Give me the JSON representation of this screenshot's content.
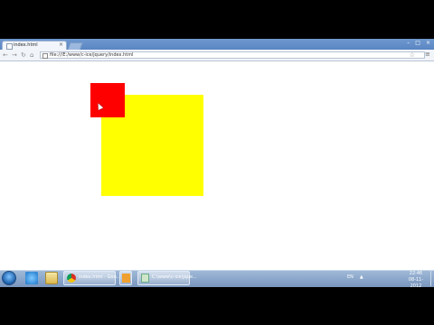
{
  "browser": {
    "tab_title": "index.html",
    "tab_close": "×",
    "url": "file:///E:/www/c-ice/jquery/index.html",
    "nav": {
      "back": "←",
      "forward": "→",
      "reload": "↻",
      "home": "⌂"
    },
    "star": "☆",
    "wrench": "≡",
    "window_controls": {
      "minimize": "–",
      "maximize": "□",
      "close": "×"
    }
  },
  "page": {
    "red_box_color": "#ff0000",
    "yellow_box_color": "#ffff00"
  },
  "taskbar": {
    "chrome_task_label": "index.html - Goo...",
    "notepad_task_label": "C:\\www\\c-ice\\jque...",
    "tray": {
      "language": "EN",
      "arrow": "▲"
    },
    "clock": {
      "time": "22:46",
      "date": "08-11-2012"
    }
  }
}
